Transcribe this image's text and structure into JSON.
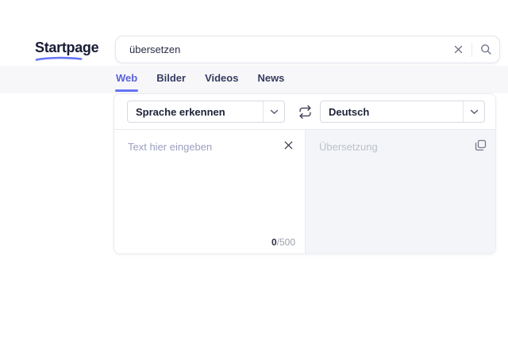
{
  "header": {
    "logo": "Startpage",
    "search": {
      "value": "übersetzen"
    }
  },
  "tabs": [
    {
      "label": "Web",
      "active": true
    },
    {
      "label": "Bilder",
      "active": false
    },
    {
      "label": "Videos",
      "active": false
    },
    {
      "label": "News",
      "active": false
    }
  ],
  "translator": {
    "source_language": "Sprache erkennen",
    "target_language": "Deutsch",
    "input_placeholder": "Text hier eingeben",
    "output_placeholder": "Übersetzung",
    "char_count": "0",
    "char_limit": "/500"
  },
  "icons": {
    "clear_search": "x-icon",
    "submit_search": "magnifier-icon",
    "swap_languages": "swap-arrows-icon",
    "clear_input": "x-icon",
    "copy_output": "copy-icon",
    "dropdown": "chevron-down-icon"
  },
  "colors": {
    "accent": "#6573f8",
    "active_tab": "#5a63d8",
    "tab_text": "#363c60",
    "logo_text": "#181c35",
    "input_placeholder": "#9ba0c0",
    "output_placeholder": "#bdc1cc",
    "output_background": "#f4f5f8",
    "band_background": "#f7f7fa"
  }
}
